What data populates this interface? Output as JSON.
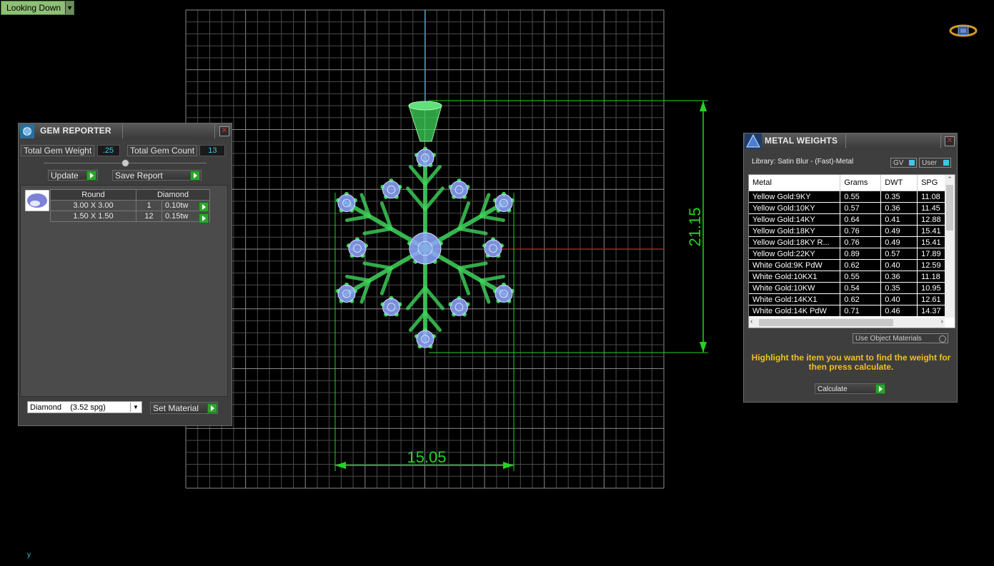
{
  "viewport": {
    "view_mode": "Looking Down",
    "axis_label": "y",
    "dimensions": {
      "height": "21.15",
      "width": "15.05"
    }
  },
  "gem_reporter": {
    "title": "GEM REPORTER",
    "total_gem_weight_label": "Total Gem Weight",
    "total_gem_weight_value": ".25",
    "total_gem_count_label": "Total Gem Count",
    "total_gem_count_value": "13",
    "update_label": "Update",
    "save_report_label": "Save Report",
    "table_headers": [
      "Round",
      "Diamond"
    ],
    "rows": [
      {
        "size": "3.00 X 3.00",
        "count": "1",
        "weight": "0.10tw"
      },
      {
        "size": "1.50 X 1.50",
        "count": "12",
        "weight": "0.15tw"
      }
    ],
    "material_selected": "Diamond    (3.52 spg)",
    "set_material_label": "Set Material"
  },
  "metal_weights": {
    "title": "METAL WEIGHTS",
    "library": "Library: Satin Blur - (Fast)-Metal",
    "gv_label": "GV",
    "user_label": "User",
    "headers": [
      "Metal",
      "Grams",
      "DWT",
      "SPG"
    ],
    "rows": [
      [
        "Yellow Gold:9KY",
        "0.55",
        "0.35",
        "11.08"
      ],
      [
        "Yellow Gold:10KY",
        "0.57",
        "0.36",
        "11.45"
      ],
      [
        "Yellow Gold:14KY",
        "0.64",
        "0.41",
        "12.88"
      ],
      [
        "Yellow Gold:18KY",
        "0.76",
        "0.49",
        "15.41"
      ],
      [
        "Yellow Gold:18KY R...",
        "0.76",
        "0.49",
        "15.41"
      ],
      [
        "Yellow Gold:22KY",
        "0.89",
        "0.57",
        "17.89"
      ],
      [
        "White Gold:9K PdW",
        "0.62",
        "0.40",
        "12.59"
      ],
      [
        "White Gold:10KX1",
        "0.55",
        "0.36",
        "11.18"
      ],
      [
        "White Gold:10KW",
        "0.54",
        "0.35",
        "10.95"
      ],
      [
        "White Gold:14KX1",
        "0.62",
        "0.40",
        "12.61"
      ],
      [
        "White Gold:14K PdW",
        "0.71",
        "0.46",
        "14.37"
      ]
    ],
    "use_object_materials_label": "Use Object Materials",
    "message": "Highlight the item you want to find the weight for then press calculate.",
    "calculate_label": "Calculate"
  },
  "colors": {
    "grid": "#9a9a9a",
    "model_green": "#3ed35a",
    "gem_blue": "#8fa8ff",
    "dimension_green": "#22d422",
    "accent_yellow": "#f0c020"
  }
}
